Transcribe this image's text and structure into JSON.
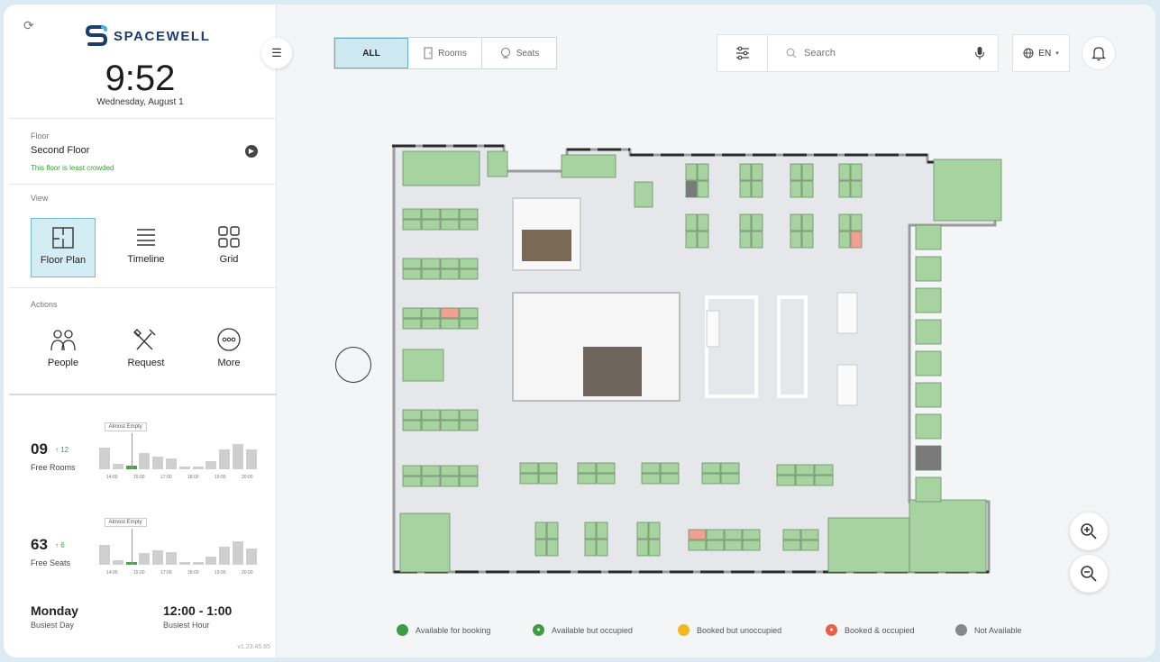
{
  "brand": {
    "name": "SPACEWELL"
  },
  "clock": {
    "time": "9:52",
    "date": "Wednesday, August 1"
  },
  "floor": {
    "section_label": "Floor",
    "name": "Second Floor",
    "note": "This floor is least crowded"
  },
  "view": {
    "section_label": "View",
    "options": [
      {
        "label": "Floor Plan",
        "icon": "floor-plan-icon",
        "active": true
      },
      {
        "label": "Timeline",
        "icon": "timeline-icon",
        "active": false
      },
      {
        "label": "Grid",
        "icon": "grid-icon",
        "active": false
      }
    ]
  },
  "actions": {
    "section_label": "Actions",
    "items": [
      {
        "label": "People",
        "icon": "people-icon"
      },
      {
        "label": "Request",
        "icon": "tools-icon"
      },
      {
        "label": "More",
        "icon": "more-icon"
      }
    ]
  },
  "stats": {
    "rooms": {
      "count": "09",
      "delta": "12",
      "label": "Free Rooms",
      "tooltip": "Almost Empty",
      "bars": [
        0.6,
        0.15,
        0.1,
        0.45,
        0.35,
        0.3,
        0.05,
        0.05,
        0.22,
        0.55,
        0.7,
        0.55
      ],
      "highlight_index": 2,
      "ticks": [
        "14:00",
        "15:00",
        "17:00",
        "18:00",
        "19:00",
        "20:00"
      ]
    },
    "seats": {
      "count": "63",
      "delta": "6",
      "label": "Free Seats",
      "tooltip": "Almost Empty",
      "bars": [
        0.55,
        0.12,
        0.06,
        0.32,
        0.4,
        0.35,
        0.05,
        0.05,
        0.22,
        0.5,
        0.65,
        0.45
      ],
      "highlight_index": 2,
      "ticks": [
        "14:00",
        "15:00",
        "17:00",
        "18:00",
        "19:00",
        "20:00"
      ]
    }
  },
  "busiest": {
    "day": "Monday",
    "day_label": "Busiest Day",
    "hour": "12:00 - 1:00",
    "hour_label": "Busiest Hour"
  },
  "version": "v1.23.45.65",
  "toolbar": {
    "tabs": [
      {
        "label": "ALL",
        "icon": "",
        "active": true
      },
      {
        "label": "Rooms",
        "icon": "door-icon",
        "active": false
      },
      {
        "label": "Seats",
        "icon": "seat-icon",
        "active": false
      }
    ],
    "search_placeholder": "Search",
    "language": "EN"
  },
  "legend": [
    {
      "label": "Available for booking",
      "color": "#3f9c45",
      "glyph": ""
    },
    {
      "label": "Available but occupied",
      "color": "#3f9c45",
      "glyph": "person"
    },
    {
      "label": "Booked but unoccupied",
      "color": "#f2b824",
      "glyph": ""
    },
    {
      "label": "Booked & occupied",
      "color": "#e8604a",
      "glyph": "person"
    },
    {
      "label": "Not Available",
      "color": "#888888",
      "glyph": ""
    }
  ],
  "colors": {
    "desk_available": "#a6d3a0",
    "desk_booked": "#f0a090",
    "desk_unavailable": "#7a7a7a",
    "accent": "#5fb1cc"
  }
}
